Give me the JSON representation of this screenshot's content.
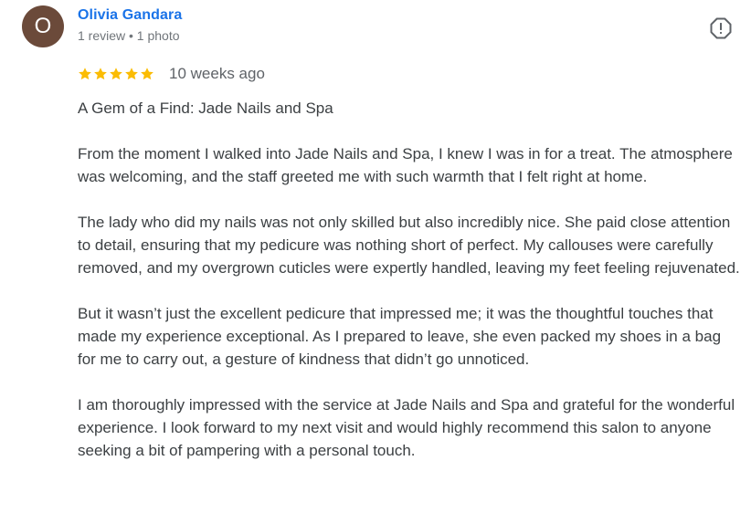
{
  "review": {
    "author": {
      "initial": "O",
      "name": "Olivia Gandara",
      "meta": "1 review • 1 photo",
      "avatar_color": "#6b4a3a"
    },
    "rating": 5,
    "max_rating": 5,
    "star_color": "#fbbc04",
    "date": "10 weeks ago",
    "flag_icon": "report-icon",
    "paragraphs": [
      "A Gem of a Find: Jade Nails and Spa",
      "From the moment I walked into Jade Nails and Spa, I knew I was in for a treat. The atmosphere was welcoming, and the staff greeted me with such warmth that I felt right at home.",
      "The lady who did my nails was not only skilled but also incredibly nice. She paid close attention to detail, ensuring that my pedicure was nothing short of perfect. My callouses were carefully removed, and my overgrown cuticles were expertly handled, leaving my feet feeling rejuvenated.",
      "But it wasn’t just the excellent pedicure that impressed me; it was the thoughtful touches that made my experience exceptional. As I prepared to leave, she even packed my shoes in a bag for me to carry out, a gesture of kindness that didn’t go unnoticed.",
      "I am thoroughly impressed with the service at Jade Nails and Spa and grateful for the wonderful experience. I look forward to my next visit and would highly recommend this salon to anyone seeking a bit of pampering with a personal touch."
    ]
  }
}
